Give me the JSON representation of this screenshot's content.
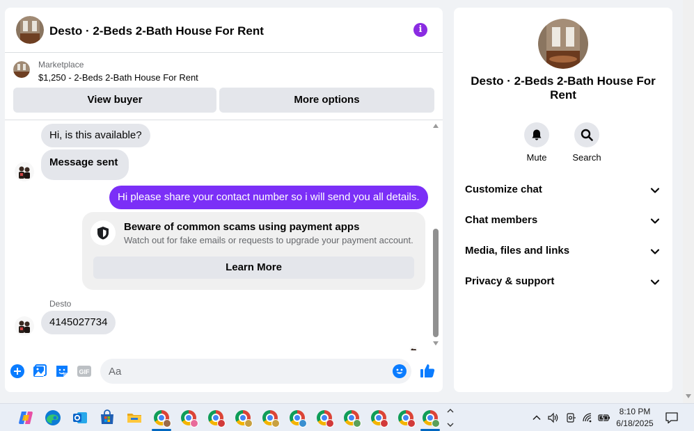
{
  "chat": {
    "title": "Desto · 2-Beds 2-Bath House For Rent",
    "listing": {
      "source": "Marketplace",
      "price_title": "$1,250 - 2-Beds 2-Bath House For Rent",
      "view_buyer": "View buyer",
      "more_options": "More options"
    },
    "messages": {
      "incoming_first": "Hi, is this available?",
      "status": "Message sent",
      "outgoing": "Hi please share your contact number so i will send you all details.",
      "sender_name": "Desto",
      "reply": "4145027734"
    },
    "scam_notice": {
      "title": "Beware of common scams using payment apps",
      "body": "Watch out for fake emails or requests to upgrade your payment account.",
      "button": "Learn More"
    },
    "composer": {
      "placeholder": "Aa",
      "gif_label": "GIF"
    }
  },
  "info_panel": {
    "title": "Desto · 2-Beds 2-Bath House For Rent",
    "actions": [
      {
        "label": "Mute",
        "icon": "bell-icon"
      },
      {
        "label": "Search",
        "icon": "search-icon"
      }
    ],
    "sections": [
      {
        "label": "Customize chat"
      },
      {
        "label": "Chat members"
      },
      {
        "label": "Media, files and links"
      },
      {
        "label": "Privacy & support"
      }
    ]
  },
  "taskbar": {
    "time": "8:10 PM",
    "date": "6/18/2025",
    "apps": [
      "copilot-icon",
      "edge-icon",
      "outlook-icon",
      "store-icon",
      "file-explorer-icon",
      "chrome-icon"
    ]
  },
  "colors": {
    "accent": "#7b2ff7",
    "messenger_blue": "#0a7cff",
    "info_purple": "#8a2be2",
    "bubble_gray": "#e4e6eb"
  }
}
